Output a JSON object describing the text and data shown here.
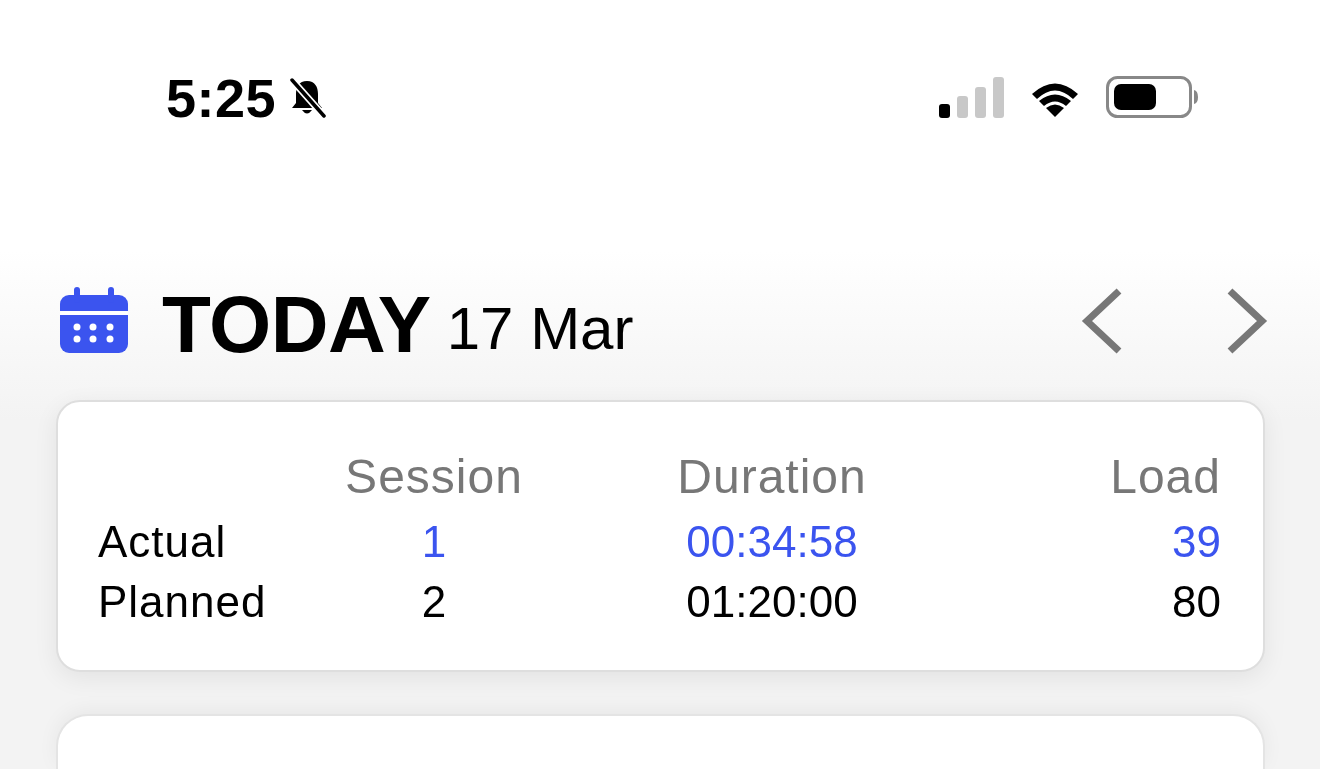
{
  "status_bar": {
    "time": "5:25",
    "silent": true
  },
  "header": {
    "title": "TODAY",
    "date": "17 Mar"
  },
  "summary": {
    "columns": [
      "Session",
      "Duration",
      "Load"
    ],
    "rows": [
      {
        "kind": "actual",
        "label": "Actual",
        "values": [
          "1",
          "00:34:58",
          "39"
        ]
      },
      {
        "kind": "planned",
        "label": "Planned",
        "values": [
          "2",
          "01:20:00",
          "80"
        ]
      }
    ]
  }
}
